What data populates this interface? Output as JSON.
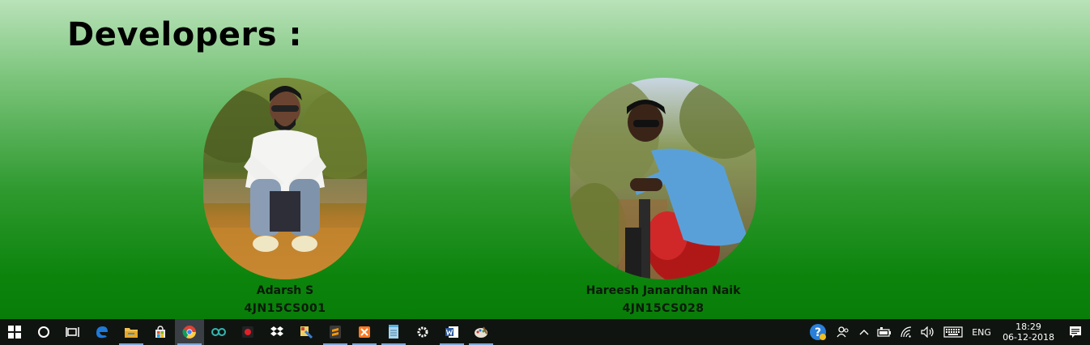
{
  "page": {
    "heading": "Developers :"
  },
  "developers": [
    {
      "name": "Adarsh S",
      "id": "4JN15CS001"
    },
    {
      "name": "Hareesh Janardhan Naik",
      "id": "4JN15CS028"
    }
  ],
  "taskbar": {
    "apps": [
      {
        "icon": "start-icon"
      },
      {
        "icon": "cortana-icon"
      },
      {
        "icon": "task-view-icon"
      },
      {
        "icon": "edge-icon"
      },
      {
        "icon": "file-explorer-icon"
      },
      {
        "icon": "store-icon"
      },
      {
        "icon": "chrome-icon"
      },
      {
        "icon": "arduino-icon"
      },
      {
        "icon": "recorder-icon"
      },
      {
        "icon": "dropbox-icon"
      },
      {
        "icon": "paint-tool-icon"
      },
      {
        "icon": "sublime-text-icon"
      },
      {
        "icon": "xampp-icon"
      },
      {
        "icon": "notepad-icon"
      },
      {
        "icon": "settings-icon"
      },
      {
        "icon": "word-icon"
      },
      {
        "icon": "paint-icon"
      }
    ],
    "tray": {
      "language": "ENG",
      "time": "18:29",
      "date": "06-12-2018"
    }
  },
  "colors": {
    "taskbar_bg": "#101410",
    "page_top": "#b9e2b9",
    "page_bottom": "#067a06"
  }
}
